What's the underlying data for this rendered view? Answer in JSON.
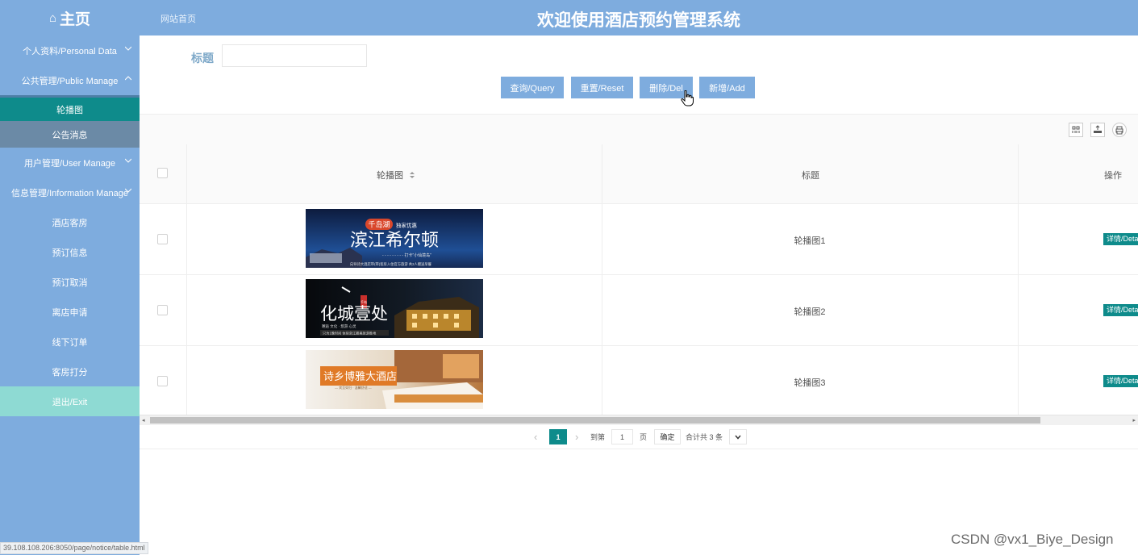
{
  "sidebar": {
    "logo_text": "主页",
    "logo_icon": "home-icon",
    "items": [
      {
        "label": "个人资料/Personal Data",
        "icon": "chevron-down-icon"
      },
      {
        "label": "公共管理/Public Manage",
        "icon": "chevron-up-icon"
      },
      {
        "label": "轮播图",
        "active": true
      },
      {
        "label": "公告消息"
      },
      {
        "label": "用户管理/User Manage",
        "icon": "chevron-down-icon"
      },
      {
        "label": "信息管理/Information Manage",
        "icon": "chevron-down-icon"
      },
      {
        "label": "酒店客房"
      },
      {
        "label": "预订信息"
      },
      {
        "label": "预订取消"
      },
      {
        "label": "离店申请"
      },
      {
        "label": "线下订单"
      },
      {
        "label": "客房打分"
      },
      {
        "label": "退出/Exit"
      }
    ],
    "status_url": "39.108.108.206:8050/page/notice/table.html"
  },
  "header": {
    "breadcrumb": "网站首页",
    "title": "欢迎使用酒店预约管理系统"
  },
  "search": {
    "label": "标题",
    "value": "",
    "placeholder": ""
  },
  "buttons": {
    "query": "查询/Query",
    "reset": "重置/Reset",
    "delete": "删除/Del",
    "add": "新增/Add"
  },
  "toolbar": {
    "icons": [
      "columns-icon",
      "export-icon",
      "print-icon"
    ]
  },
  "table": {
    "headers": [
      "轮播图",
      "标题",
      "操作"
    ],
    "rows": [
      {
        "title": "轮播图1",
        "action": "详情/Detail",
        "image": {
          "brand": "千岛湖",
          "tag": "独家优惠",
          "headline": "滨江希尔顿",
          "sub": "- - - - - - - - - 打卡“小仙境岛”",
          "foot": "向导诗大酒店带(带)客房入住官方旅游 共2人赠送早餐"
        }
      },
      {
        "title": "轮播图2",
        "action": "详情/Detail",
        "image": {
          "headline": "化城壹处",
          "seal": "千岛",
          "sub": "邂逅 文化 · 悠游 心灵",
          "foot": "只为1晚时间 体验浙江最美旅游胜地"
        }
      },
      {
        "title": "轮播图3",
        "action": "详情/Detail",
        "image": {
          "headline": "诗乡博雅大酒店",
          "sub": "— 宾至如归 · 温馨舒适 —"
        }
      }
    ]
  },
  "pager": {
    "current_page": "1",
    "goto_label": "到第",
    "goto_value": "1",
    "page_unit": "页",
    "confirm": "确定",
    "total": "合计共 3 条"
  },
  "watermark": "CSDN @vx1_Biye_Design",
  "colors": {
    "primary": "#7eacde",
    "accent_teal": "#0e8b8b",
    "exit_bg": "#8edad3"
  }
}
